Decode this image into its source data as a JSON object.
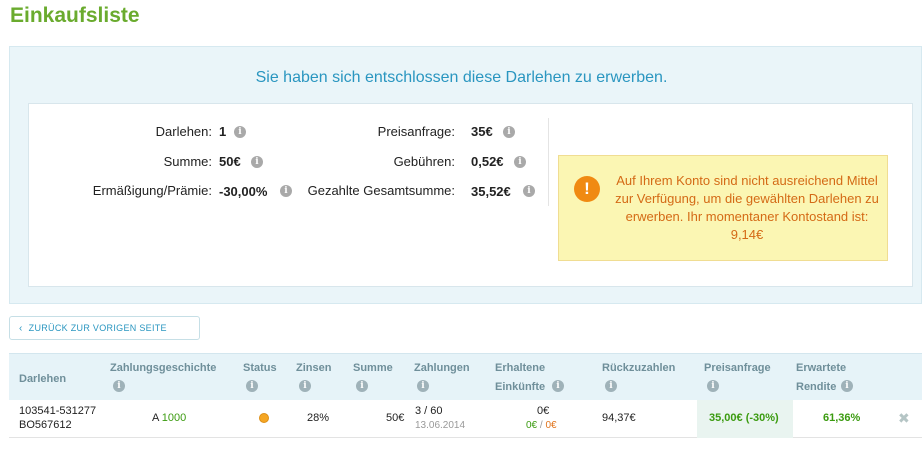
{
  "page": {
    "title": "Einkaufsliste"
  },
  "summary": {
    "heading": "Sie haben sich entschlossen diese Darlehen zu erwerben.",
    "left_stats": [
      {
        "label": "Darlehen:",
        "value": "1"
      },
      {
        "label": "Summe:",
        "value": "50€"
      },
      {
        "label": "Ermäßigung/Prämie:",
        "value": "-30,00%"
      }
    ],
    "right_stats": [
      {
        "label": "Preisanfrage:",
        "value": "35€"
      },
      {
        "label": "Gebühren:",
        "value": "0,52€"
      },
      {
        "label": "Gezahlte Gesamtsumme:",
        "value": "35,52€"
      }
    ],
    "warning": "Auf Ihrem Konto sind nicht ausreichend Mittel zur Verfügung, um die gewählten Darlehen zu erwerben. Ihr momentaner Kontostand ist: 9,14€"
  },
  "back_button": {
    "label": "ZURÜCK ZUR VORIGEN SEITE"
  },
  "table": {
    "headers": {
      "darlehen": "Darlehen",
      "zahlungsgeschichte": "Zahlungsgeschichte",
      "status": "Status",
      "zinsen": "Zinsen",
      "summe": "Summe",
      "zahlungen": "Zahlungen",
      "erhaltene_1": "Erhaltene",
      "erhaltene_2": "Einkünfte",
      "rueckzuzahlen": "Rückzuzahlen",
      "preisanfrage": "Preisanfrage",
      "rendite_1": "Erwartete",
      "rendite_2": "Rendite"
    },
    "row": {
      "loan_id": "103541-531277",
      "loan_code": "BO567612",
      "history_grade": "A",
      "history_score": "1000",
      "status_color": "#f5a623",
      "zinsen": "28%",
      "summe": "50€",
      "zahlungen": "3 / 60",
      "zahlungen_date": "13.06.2014",
      "einkuenfte": "0€",
      "einkuenfte_a": "0€",
      "einkuenfte_sep": " / ",
      "einkuenfte_b": "0€",
      "rueckzuzahlen": "94,37€",
      "preisanfrage": "35,00€ (-30%)",
      "rendite": "61,36%"
    }
  },
  "icons": {
    "info": "i",
    "warning": "!",
    "back": "‹",
    "remove": "✖"
  }
}
